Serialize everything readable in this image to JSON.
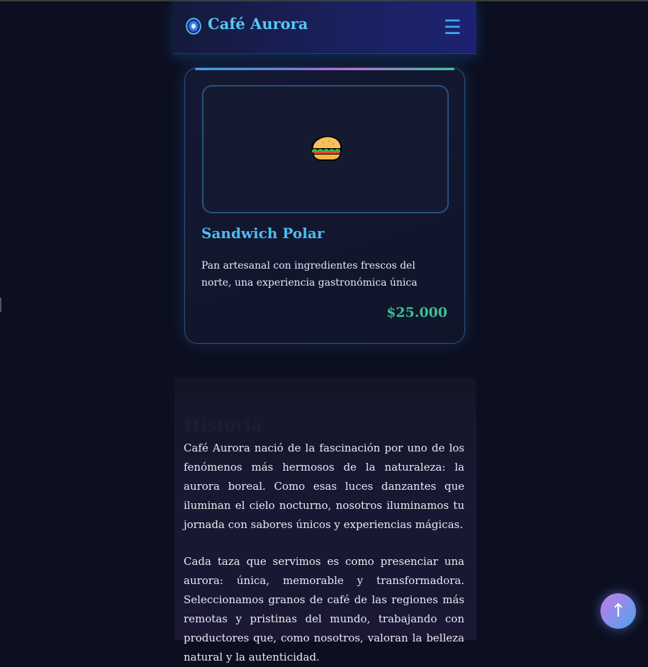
{
  "header": {
    "brand": "Café Aurora",
    "logo_icon": "aurora-gem-icon",
    "menu_icon": "hamburger-menu-icon",
    "menu_glyph": "☰"
  },
  "menu_item": {
    "image_icon": "sandwich-icon",
    "title": "Sandwich Polar",
    "description": "Pan artesanal con ingredientes frescos del norte, una experiencia gastronómica única",
    "price": "$25.000"
  },
  "history": {
    "title": "Historia",
    "paragraphs": [
      "Café Aurora nació de la fascinación por uno de los fenómenos más hermosos de la naturaleza: la aurora boreal. Como esas luces danzantes que iluminan el cielo nocturno, nosotros iluminamos tu jornada con sabores únicos y experiencias mágicas.",
      "Cada taza que servimos es como presenciar una aurora: única, memorable y transformadora. Seleccionamos granos de café de las regiones más remotas y pristinas del mundo, trabajando con productores que, como nosotros, valoran la belleza natural y la autenticidad."
    ]
  },
  "scroll_top": {
    "icon": "arrow-up-icon",
    "glyph": "↑"
  },
  "colors": {
    "background": "#0c0f20",
    "accent": "#4cbdf0",
    "price": "#3dbd92"
  }
}
